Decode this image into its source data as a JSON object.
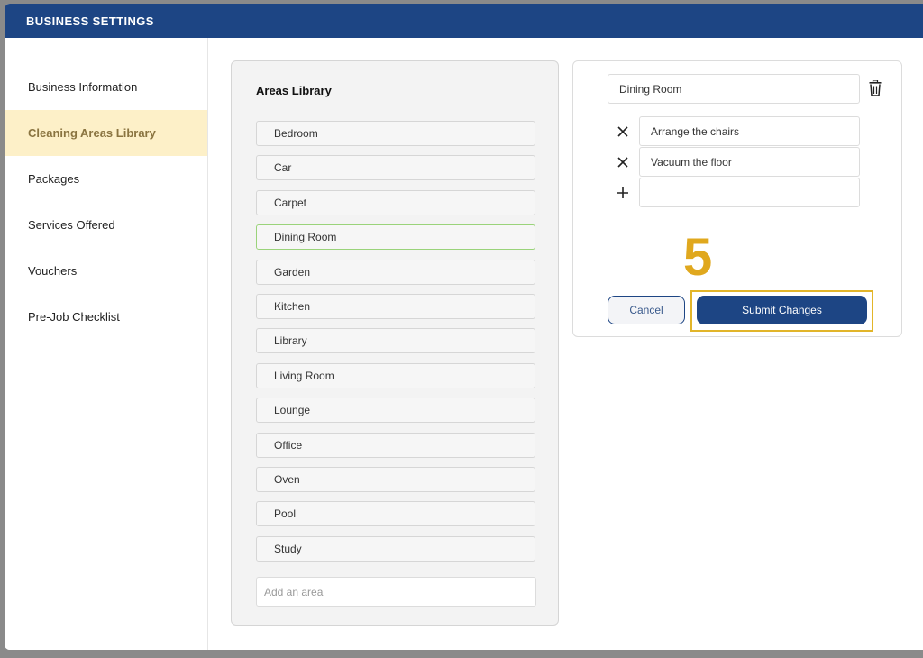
{
  "header": {
    "title": "BUSINESS SETTINGS"
  },
  "sidebar": {
    "items": [
      {
        "label": "Business Information"
      },
      {
        "label": "Cleaning Areas Library"
      },
      {
        "label": "Packages"
      },
      {
        "label": "Services Offered"
      },
      {
        "label": "Vouchers"
      },
      {
        "label": "Pre-Job Checklist"
      }
    ],
    "active_index": 1
  },
  "library": {
    "title": "Areas Library",
    "areas": [
      {
        "label": "Bedroom"
      },
      {
        "label": "Car"
      },
      {
        "label": "Carpet"
      },
      {
        "label": "Dining Room"
      },
      {
        "label": "Garden"
      },
      {
        "label": "Kitchen"
      },
      {
        "label": "Library"
      },
      {
        "label": "Living Room"
      },
      {
        "label": "Lounge"
      },
      {
        "label": "Office"
      },
      {
        "label": "Oven"
      },
      {
        "label": "Pool"
      },
      {
        "label": "Study"
      }
    ],
    "selected": "Dining Room",
    "add_placeholder": "Add an area"
  },
  "editor": {
    "area_name": "Dining Room",
    "tasks": [
      {
        "text": "Arrange the chairs"
      },
      {
        "text": "Vacuum the floor"
      }
    ],
    "new_task_value": "",
    "step_number": "5",
    "cancel_label": "Cancel",
    "submit_label": "Submit Changes"
  },
  "colors": {
    "header_bg": "#1d4584",
    "active_nav_bg": "#fdf0c8",
    "selected_border": "#9ad37a",
    "highlight": "#e2b52a"
  },
  "icons": {
    "delete": "trash-icon",
    "remove_task": "close-icon",
    "add_task": "plus-icon"
  }
}
